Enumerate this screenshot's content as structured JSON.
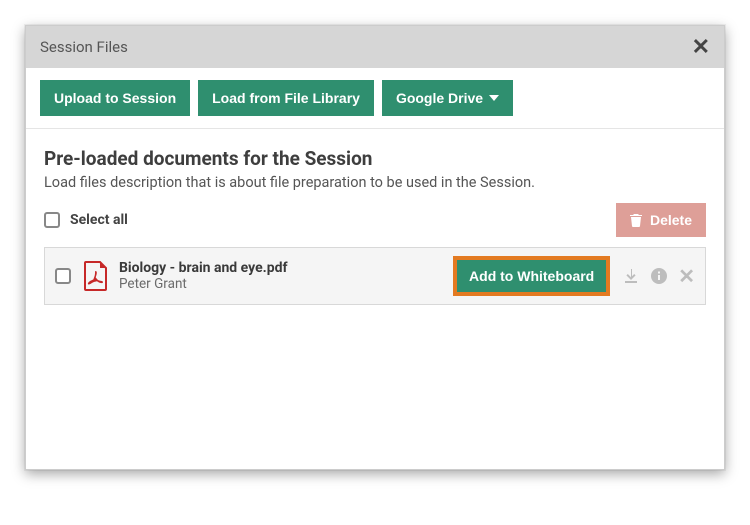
{
  "dialog": {
    "title": "Session Files"
  },
  "toolbar": {
    "upload_label": "Upload to Session",
    "load_library_label": "Load from File Library",
    "google_drive_label": "Google Drive"
  },
  "section": {
    "title": "Pre-loaded documents for the Session",
    "description": "Load files description that is about file preparation to be used in the Session."
  },
  "controls": {
    "select_all_label": "Select all",
    "delete_label": "Delete"
  },
  "files": [
    {
      "name": "Biology - brain and eye.pdf",
      "author": "Peter Grant",
      "add_label": "Add to Whiteboard"
    }
  ],
  "colors": {
    "primary": "#2f8f6f",
    "highlight": "#e37a21",
    "danger": "#d98f87"
  }
}
